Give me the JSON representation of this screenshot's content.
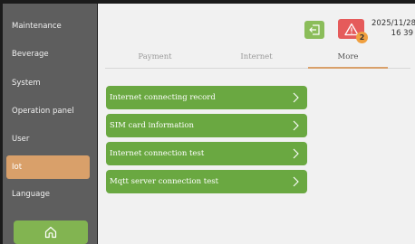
{
  "sidebar": {
    "items": [
      {
        "label": "Maintenance"
      },
      {
        "label": "Beverage"
      },
      {
        "label": "System"
      },
      {
        "label": "Operation panel"
      },
      {
        "label": "User"
      },
      {
        "label": "Iot",
        "active": true
      },
      {
        "label": "Language"
      }
    ]
  },
  "header": {
    "alarm_count": "2",
    "date": "2025/11/28",
    "time": "16 39"
  },
  "tabs": [
    {
      "label": "Payment"
    },
    {
      "label": "Internet"
    },
    {
      "label": "More",
      "active": true
    }
  ],
  "menu": [
    {
      "label": "Internet connecting record"
    },
    {
      "label": "SIM card information"
    },
    {
      "label": "Internet connection test"
    },
    {
      "label": "Mqtt server connection test"
    }
  ],
  "colors": {
    "sidebar_bg": "#5e5e5e",
    "active_item": "#d9a06a",
    "home_button": "#82b451",
    "menu_button": "#6aa841",
    "alarm": "#e55b5b",
    "main_bg": "#f1f1f1"
  },
  "icons": [
    "home-icon",
    "logout-icon",
    "warning-icon",
    "chevron-right-icon"
  ]
}
